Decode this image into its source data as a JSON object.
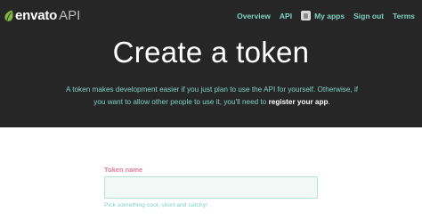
{
  "nav": {
    "brand": "envato",
    "brand_suffix": "API",
    "links": [
      "Overview",
      "API",
      "My apps",
      "Sign out",
      "Terms"
    ]
  },
  "hero": {
    "title": "Create a token",
    "desc_before": "A token makes development easier if you just plan to use the API for yourself. Otherwise, if you want to allow other people to use it, you'll need to ",
    "desc_link": "register your app",
    "desc_after": "."
  },
  "form": {
    "label": "Token name",
    "value": "",
    "placeholder": "",
    "help": "Pick something cool, short and catchy!"
  },
  "icons": {
    "brand_logo": "envato-leaf-icon",
    "my_apps": "app-icon"
  },
  "colors": {
    "hero_bg": "#262626",
    "accent": "#7fd1c0",
    "label_pink": "#e07ba0",
    "leaf_green": "#82b541"
  }
}
